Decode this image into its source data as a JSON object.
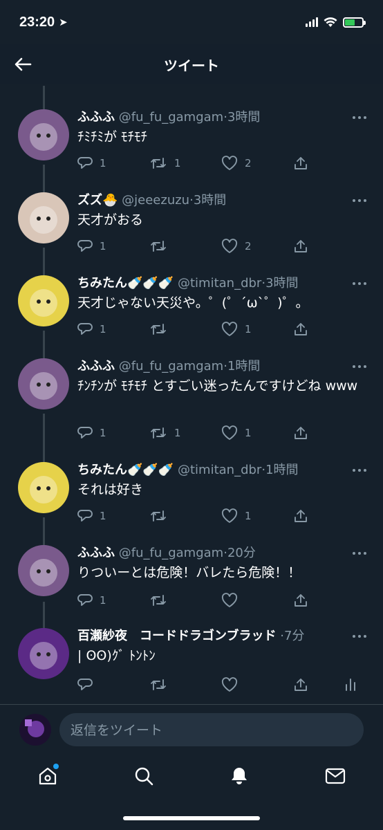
{
  "status_bar": {
    "time": "23:20"
  },
  "header": {
    "title": "ツイート"
  },
  "tweets": [
    {
      "name": "ふふふ",
      "handle": "@fu_fu_gamgam",
      "time": "3時間",
      "text": "ﾁﾐﾁﾐが ﾓﾁﾓﾁ",
      "reply_count": "1",
      "retweet_count": "1",
      "like_count": "2",
      "avatar_color": "#7a5a8c"
    },
    {
      "name": "ズズ🐣",
      "handle": "@jeeezuzu",
      "time": "3時間",
      "text": "天才がおる",
      "reply_count": "1",
      "retweet_count": "",
      "like_count": "2",
      "avatar_color": "#d9c6b8"
    },
    {
      "name": "ちみたん🍼🍼🍼",
      "handle": "@timitan_dbr",
      "time": "3時間",
      "text": "天才じゃない天災や。゜(゜´ω`゜)゜。",
      "reply_count": "1",
      "retweet_count": "",
      "like_count": "1",
      "avatar_color": "#e6d24a"
    },
    {
      "name": "ふふふ",
      "handle": "@fu_fu_gamgam",
      "time": "1時間",
      "text": "ﾁﾝﾁﾝが ﾓﾁﾓﾁ とすごい迷ったんですけどね www",
      "reply_count": "1",
      "retweet_count": "1",
      "like_count": "1",
      "avatar_color": "#7a5a8c"
    },
    {
      "name": "ちみたん🍼🍼🍼",
      "handle": "@timitan_dbr",
      "time": "1時間",
      "text": "それは好き",
      "reply_count": "1",
      "retweet_count": "",
      "like_count": "1",
      "avatar_color": "#e6d24a"
    },
    {
      "name": "ふふふ",
      "handle": "@fu_fu_gamgam",
      "time": "20分",
      "text": "りついーとは危険！バレたら危険！！",
      "reply_count": "1",
      "retweet_count": "",
      "like_count": "",
      "avatar_color": "#7a5a8c"
    },
    {
      "name": "百瀬紗夜　コードドラゴンブラッド",
      "handle": "",
      "time": "7分",
      "text": "|  ʘʘ)ｸﾞ ﾄﾝﾄﾝ",
      "reply_count": "",
      "retweet_count": "",
      "like_count": "",
      "avatar_color": "#5b2a86"
    }
  ],
  "reply_bar": {
    "placeholder": "返信をツイート"
  },
  "colors": {
    "background": "#15202b",
    "secondary_text": "#8899a6",
    "accent": "#1da1f2",
    "battery": "#34c759"
  },
  "tabbar": {
    "icons": [
      "home-icon",
      "search-icon",
      "bell-icon",
      "mail-icon"
    ]
  }
}
